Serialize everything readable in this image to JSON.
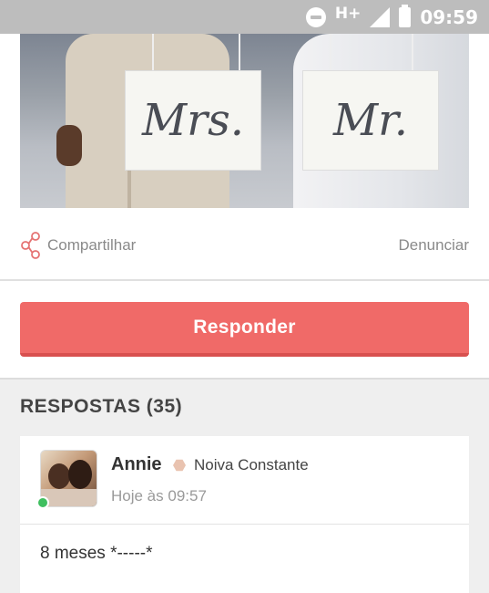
{
  "status_bar": {
    "network": "H+",
    "time": "09:59"
  },
  "post": {
    "image_signs": [
      "Mrs.",
      "Mr."
    ],
    "share_label": "Compartilhar",
    "report_label": "Denunciar"
  },
  "reply": {
    "button_label": "Responder"
  },
  "answers": {
    "title": "RESPOSTAS (35)",
    "items": [
      {
        "author": "Annie",
        "rank": "Noiva Constante",
        "time": "Hoje às 09:57",
        "text": "8 meses *-----*",
        "online_color": "#3fbf5f"
      }
    ]
  },
  "colors": {
    "accent": "#f06a68",
    "rank_badge": "#e9c3b0",
    "status_bar": "#bdbdbd"
  }
}
